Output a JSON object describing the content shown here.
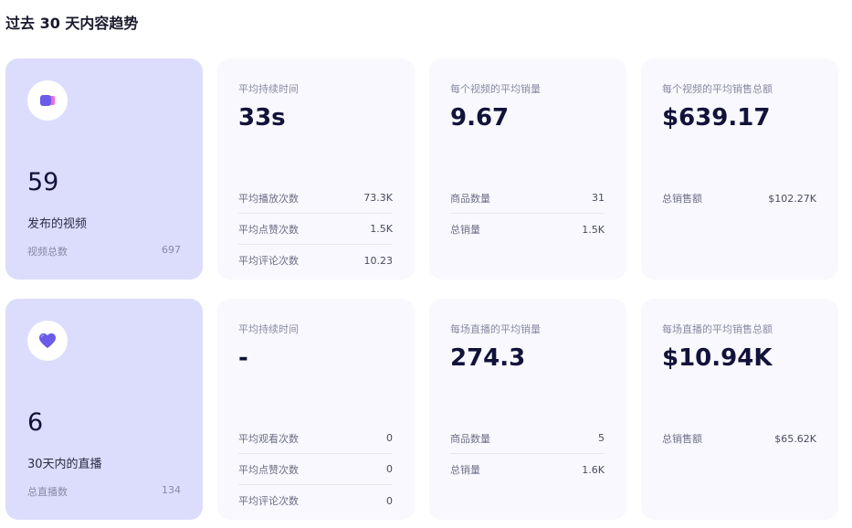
{
  "title": "过去 30 天内容趋势",
  "colors": {
    "highlight_bg": "#dcdcfd",
    "card_bg": "#f8f8fe",
    "icon_accent": "#6a5ce8"
  },
  "videos": {
    "summary": {
      "icon": "video-icon",
      "value": "59",
      "label": "发布的视频",
      "footer_label": "视频总数",
      "footer_value": "697"
    },
    "duration": {
      "label": "平均持续时间",
      "value": "33s",
      "rows": [
        {
          "label": "平均播放次数",
          "value": "73.3K"
        },
        {
          "label": "平均点赞次数",
          "value": "1.5K"
        },
        {
          "label": "平均评论次数",
          "value": "10.23"
        }
      ]
    },
    "avg_sales": {
      "label": "每个视频的平均销量",
      "value": "9.67",
      "rows": [
        {
          "label": "商品数量",
          "value": "31"
        },
        {
          "label": "总销量",
          "value": "1.5K"
        }
      ]
    },
    "avg_revenue": {
      "label": "每个视频的平均销售总额",
      "value": "$639.17",
      "rows": [
        {
          "label": "总销售额",
          "value": "$102.27K"
        }
      ]
    }
  },
  "lives": {
    "summary": {
      "icon": "heart-icon",
      "value": "6",
      "label": "30天内的直播",
      "footer_label": "总直播数",
      "footer_value": "134"
    },
    "duration": {
      "label": "平均持续时间",
      "value": "-",
      "rows": [
        {
          "label": "平均观看次数",
          "value": "0"
        },
        {
          "label": "平均点赞次数",
          "value": "0"
        },
        {
          "label": "平均评论次数",
          "value": "0"
        }
      ]
    },
    "avg_sales": {
      "label": "每场直播的平均销量",
      "value": "274.3",
      "rows": [
        {
          "label": "商品数量",
          "value": "5"
        },
        {
          "label": "总销量",
          "value": "1.6K"
        }
      ]
    },
    "avg_revenue": {
      "label": "每场直播的平均销售总额",
      "value": "$10.94K",
      "rows": [
        {
          "label": "总销售额",
          "value": "$65.62K"
        }
      ]
    }
  }
}
